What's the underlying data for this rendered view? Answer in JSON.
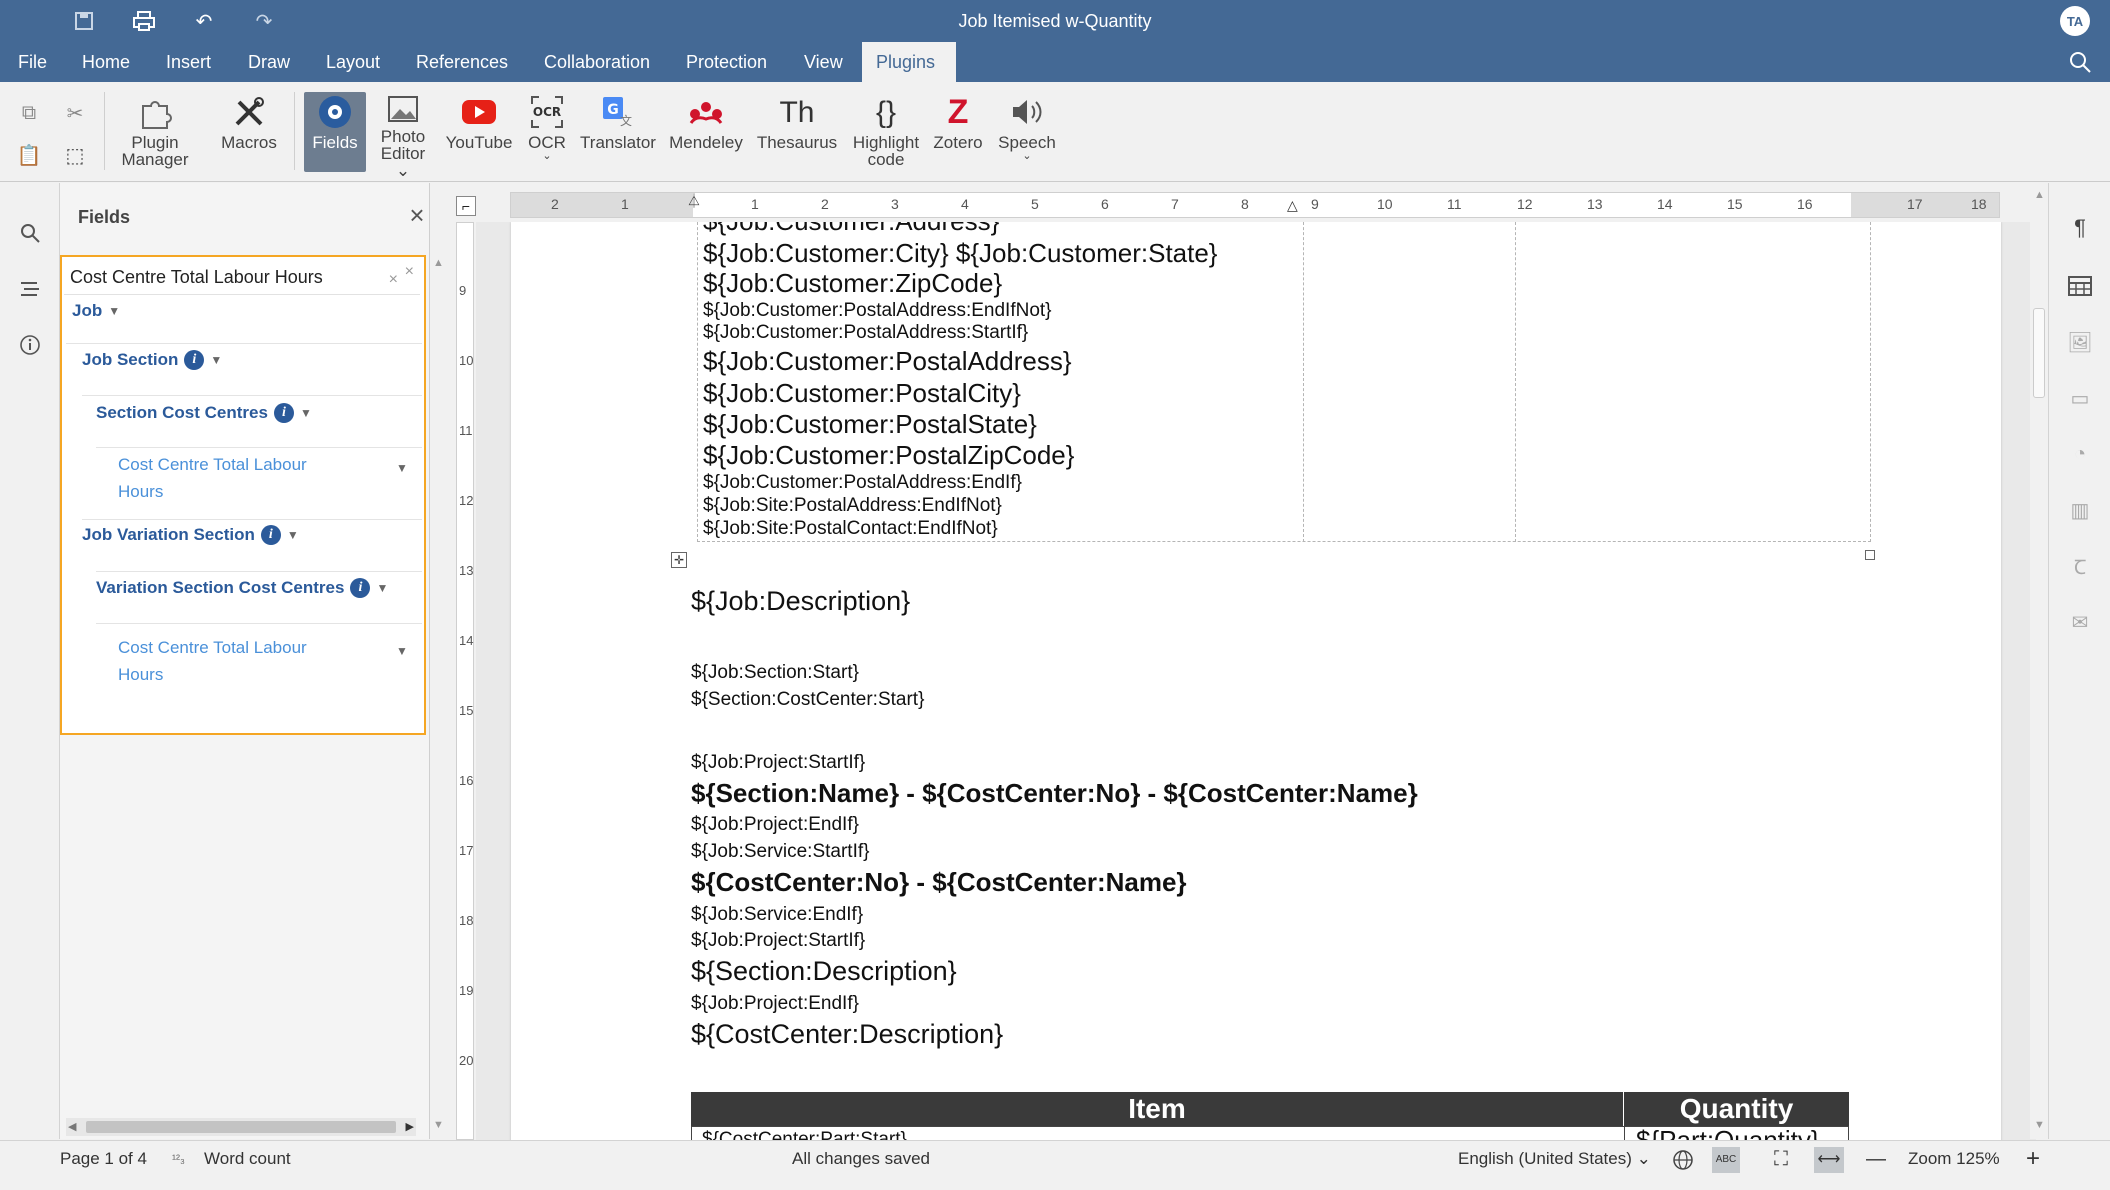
{
  "window": {
    "title": "Job Itemised w-Quantity",
    "user_initials": "TA"
  },
  "menu": {
    "tabs": [
      "File",
      "Home",
      "Insert",
      "Draw",
      "Layout",
      "References",
      "Collaboration",
      "Protection",
      "View",
      "Plugins"
    ],
    "active": "Plugins"
  },
  "toolbar": {
    "plugin_manager": [
      "Plugin",
      "Manager"
    ],
    "macros": "Macros",
    "fields": "Fields",
    "photo_editor": [
      "Photo",
      "Editor"
    ],
    "youtube": "YouTube",
    "ocr": "OCR",
    "translator": "Translator",
    "mendeley": "Mendeley",
    "thesaurus": "Thesaurus",
    "highlight_code": [
      "Highlight",
      "code"
    ],
    "zotero": "Zotero",
    "speech": "Speech"
  },
  "fields_panel": {
    "title": "Fields",
    "search_value": "Cost Centre Total Labour Hours",
    "tree": {
      "job": "Job",
      "job_section": "Job Section",
      "section_cost_centres": "Section Cost Centres",
      "leaf1": "Cost Centre Total Labour Hours",
      "job_variation_section": "Job Variation Section",
      "variation_section_cost_centres": "Variation Section Cost Centres",
      "leaf2": "Cost Centre Total Labour Hours"
    }
  },
  "ruler": {
    "h_labels": [
      "2",
      "1",
      "1",
      "2",
      "3",
      "4",
      "5",
      "6",
      "7",
      "8",
      "9",
      "10",
      "11",
      "12",
      "13",
      "14",
      "15",
      "16",
      "17",
      "18"
    ],
    "v_labels": [
      "9",
      "10",
      "11",
      "12",
      "13",
      "14",
      "15",
      "16",
      "17",
      "18",
      "19",
      "20"
    ]
  },
  "document": {
    "table_lines": [
      "${Job:Customer:Address}",
      "${Job:Customer:City} ${Job:Customer:State}",
      "${Job:Customer:ZipCode}",
      "${Job:Customer:PostalAddress:EndIfNot}",
      "${Job:Customer:PostalAddress:StartIf}",
      "${Job:Customer:PostalAddress}",
      "${Job:Customer:PostalCity}",
      "${Job:Customer:PostalState}",
      "${Job:Customer:PostalZipCode}",
      "${Job:Customer:PostalAddress:EndIf}",
      "${Job:Site:PostalAddress:EndIfNot}",
      "${Job:Site:PostalContact:EndIfNot}"
    ],
    "body_lines": [
      "${Job:Description}",
      "${Job:Section:Start}",
      "${Section:CostCenter:Start}",
      "${Job:Project:StartIf}",
      "${Section:Name} - ${CostCenter:No} - ${CostCenter:Name}",
      "${Job:Project:EndIf}",
      "${Job:Service:StartIf}",
      "${CostCenter:No} - ${CostCenter:Name}",
      "${Job:Service:EndIf}",
      "${Job:Project:StartIf}",
      "${Section:Description}",
      "${Job:Project:EndIf}",
      "${CostCenter:Description}"
    ],
    "items_table": {
      "headers": [
        "Item",
        "Quantity"
      ],
      "row1": [
        "${CostCenter:Part:Start}",
        "${Part:Quantity}"
      ]
    }
  },
  "statusbar": {
    "page": "Page 1 of 4",
    "word_count": "Word count",
    "saved": "All changes saved",
    "language": "English (United States)",
    "zoom": "Zoom 125%"
  },
  "colors": {
    "accent": "#446995",
    "highlight": "#f5a623",
    "tree_node": "#2b5a9a",
    "tree_leaf": "#4a90d9"
  }
}
